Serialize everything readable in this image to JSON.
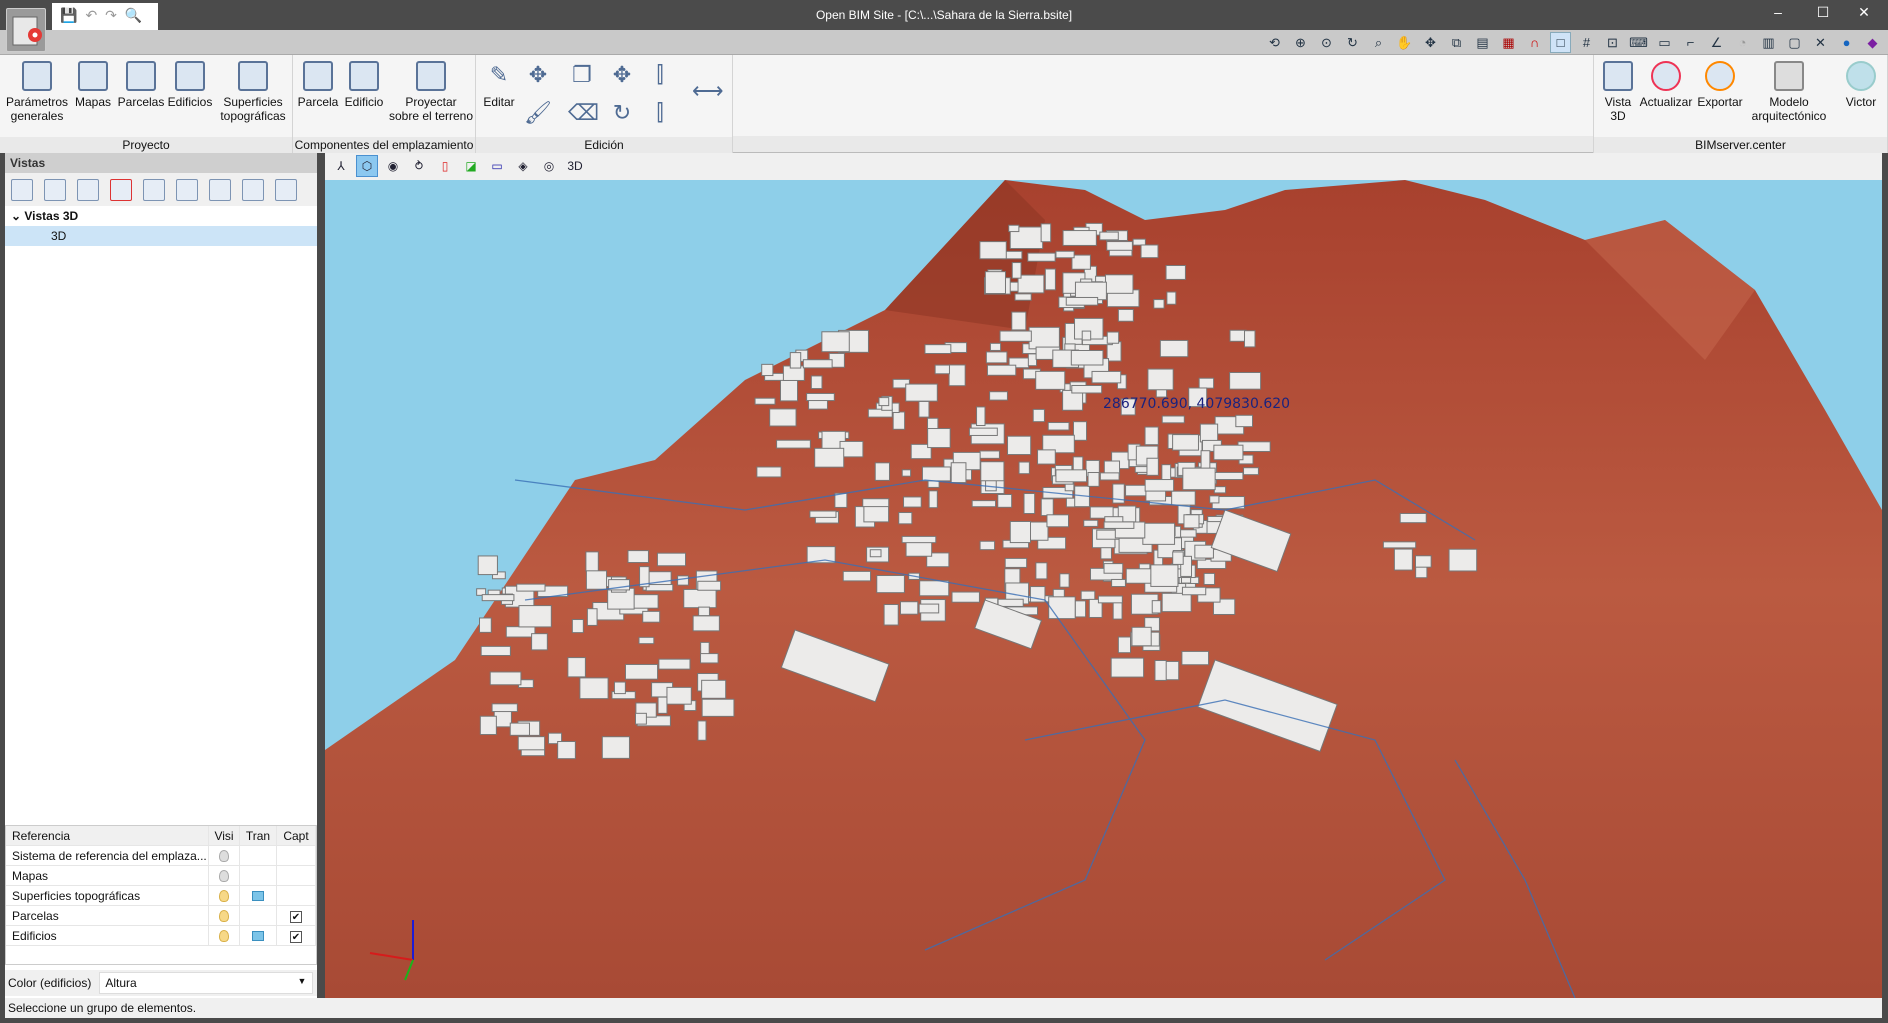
{
  "window": {
    "title": "Open BIM Site - [C:\\...\\Sahara de la Sierra.bsite]",
    "minimize": "–",
    "maximize": "☐",
    "close": "✕"
  },
  "qat": [
    "save-icon",
    "undo-icon",
    "redo-icon",
    "search-icon"
  ],
  "ribbon": {
    "proyecto": {
      "label": "Proyecto",
      "items": [
        "Parámetros\ngenerales",
        "Mapas",
        "Parcelas",
        "Edificios",
        "Superficies\ntopográficas"
      ]
    },
    "componentes": {
      "label": "Componentes del emplazamiento",
      "items": [
        "Parcela",
        "Edificio",
        "Proyectar\nsobre el terreno"
      ]
    },
    "edicion": {
      "label": "Edición",
      "editar": "Editar"
    },
    "bimserver": {
      "label": "BIMserver.center",
      "items": [
        "Vista\n3D",
        "Actualizar",
        "Exportar",
        "Modelo\narquitectónico",
        "Victor"
      ]
    }
  },
  "left": {
    "header": "Vistas",
    "tree": {
      "group": "Vistas 3D",
      "item": "3D"
    },
    "table": {
      "columns": [
        "Referencia",
        "Visi",
        "Tran",
        "Capt"
      ],
      "rows": [
        {
          "name": "Sistema de referencia del emplaza...",
          "visible": false,
          "transparent": false,
          "capture": null
        },
        {
          "name": "Mapas",
          "visible": false,
          "transparent": false,
          "capture": null
        },
        {
          "name": "Superficies topográficas",
          "visible": true,
          "transparent": true,
          "capture": null
        },
        {
          "name": "Parcelas",
          "visible": true,
          "transparent": false,
          "capture": true
        },
        {
          "name": "Edificios",
          "visible": true,
          "transparent": true,
          "capture": true
        }
      ]
    },
    "color_label": "Color (edificios)",
    "color_value": "Altura"
  },
  "viewport": {
    "coordinates": "286770.690, 4079830.620",
    "sky": "#8ecfe9",
    "terrain": "#b5533c"
  },
  "status": "Seleccione un grupo de elementos."
}
